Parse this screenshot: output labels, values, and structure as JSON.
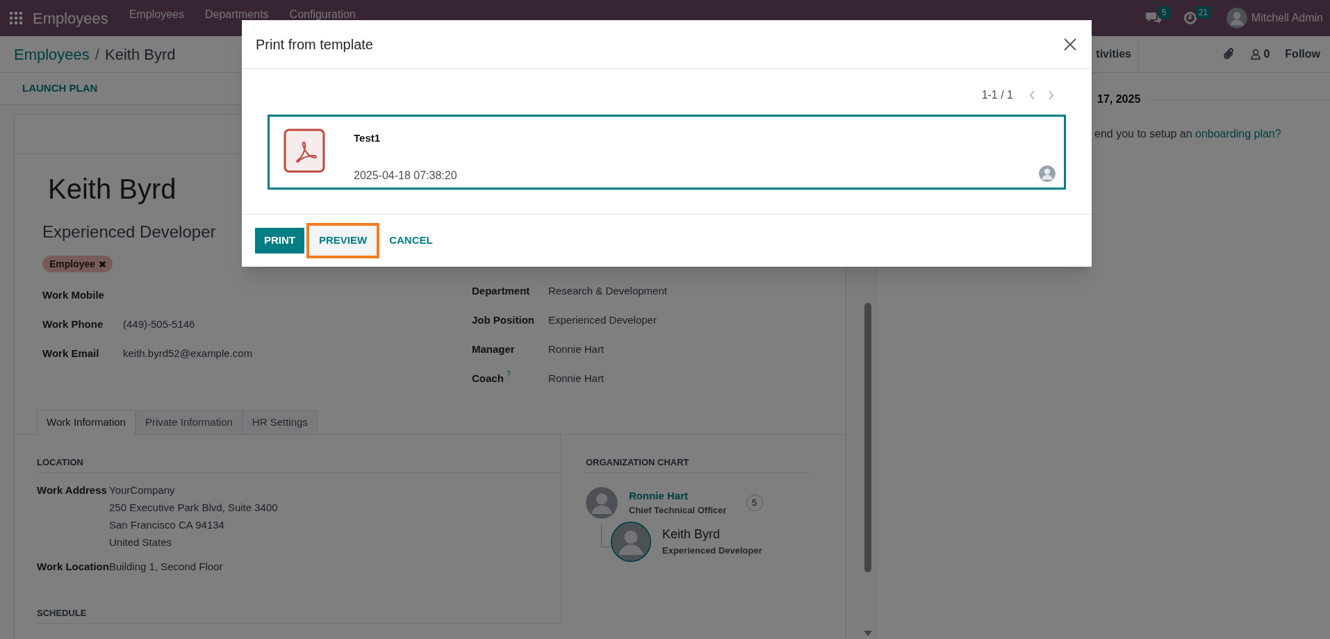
{
  "navbar": {
    "app_name": "Employees",
    "menu": [
      "Employees",
      "Departments",
      "Configuration"
    ],
    "messages_badge": "5",
    "activities_badge": "21",
    "user_name": "Mitchell Admin"
  },
  "breadcrumb": {
    "parent": "Employees",
    "separator": "/",
    "current": "Keith Byrd"
  },
  "action_buttons": [
    "LAUNCH PLAN"
  ],
  "employee": {
    "name": "Keith Byrd",
    "job_title": "Experienced Developer",
    "tags": [
      "Employee"
    ]
  },
  "fields_left": [
    {
      "label": "Work Mobile"
    },
    {
      "label": "Work Phone",
      "value": "(449)-505-5146"
    },
    {
      "label": "Work Email",
      "value": "keith.byrd52@example.com"
    }
  ],
  "fields_right": [
    {
      "label": "Department",
      "value": "Research & Development"
    },
    {
      "label": "Job Position",
      "value": "Experienced Developer"
    },
    {
      "label": "Manager",
      "value": "Ronnie Hart"
    },
    {
      "label": "Coach",
      "help": "?",
      "value": "Ronnie Hart"
    }
  ],
  "tabs": [
    {
      "label": "Work Information",
      "selected": true
    },
    {
      "label": "Private Information",
      "selected": false
    },
    {
      "label": "HR Settings",
      "selected": false
    }
  ],
  "location": {
    "heading": "LOCATION",
    "fields": [
      {
        "label": "Work Address",
        "lines": [
          "YourCompany",
          "250 Executive Park Blvd, Suite 3400",
          "San Francisco CA 94134",
          "United States"
        ]
      },
      {
        "label": "Work Location",
        "lines": [
          "Building 1, Second Floor"
        ]
      }
    ]
  },
  "schedule_heading": "SCHEDULE",
  "org_chart": {
    "heading": "ORGANIZATION CHART",
    "manager": {
      "name": "Ronnie Hart",
      "title": "Chief Technical Officer",
      "subordinates": "5"
    },
    "employee": {
      "name": "Keith Byrd",
      "title": "Experienced Developer"
    }
  },
  "chatter": {
    "toolbar_text": "tivities",
    "followers": "0",
    "follow_label": "Follow",
    "date_separator": "17, 2025",
    "message": {
      "text": "end you to setup an ",
      "link": "onboarding plan?"
    }
  },
  "dialog": {
    "title": "Print from template",
    "pager": "1-1 / 1",
    "templates": [
      {
        "name": "Test1",
        "date": "2025-04-18 07:38:20",
        "selected": true
      }
    ],
    "buttons": [
      {
        "label": "PRINT",
        "kind": "primary",
        "highlighted": false
      },
      {
        "label": "PREVIEW",
        "kind": "secondary",
        "highlighted": true
      },
      {
        "label": "CANCEL",
        "kind": "link",
        "highlighted": false
      }
    ]
  }
}
